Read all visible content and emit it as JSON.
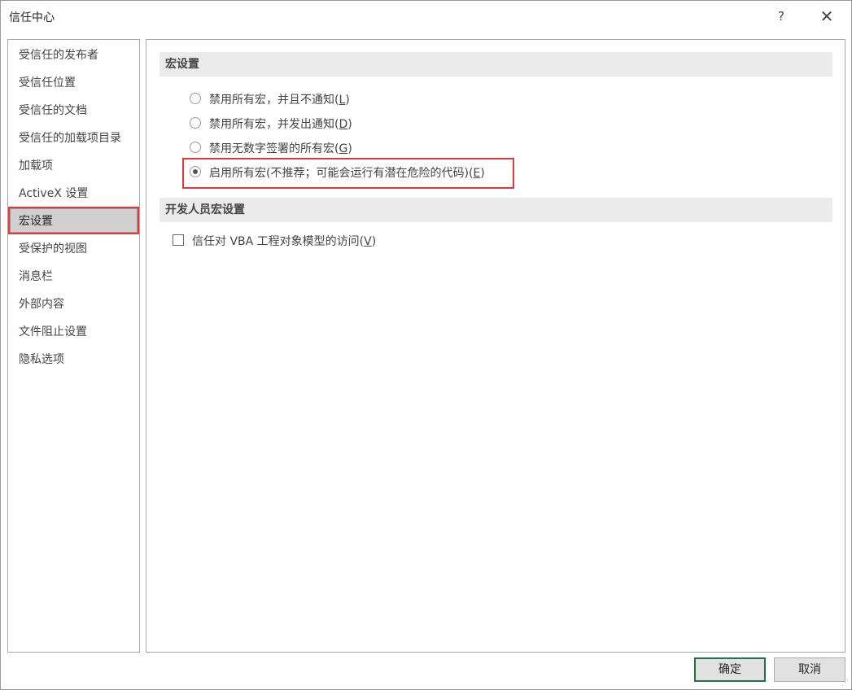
{
  "window": {
    "title": "信任中心",
    "help_glyph": "?",
    "close_glyph": "✕"
  },
  "sidebar": {
    "items": [
      {
        "label": "受信任的发布者"
      },
      {
        "label": "受信任位置"
      },
      {
        "label": "受信任的文档"
      },
      {
        "label": "受信任的加载项目录"
      },
      {
        "label": "加载项"
      },
      {
        "label": "ActiveX 设置"
      },
      {
        "label": "宏设置",
        "selected": true
      },
      {
        "label": "受保护的视图"
      },
      {
        "label": "消息栏"
      },
      {
        "label": "外部内容"
      },
      {
        "label": "文件阻止设置"
      },
      {
        "label": "隐私选项"
      }
    ]
  },
  "macro_settings": {
    "header": "宏设置",
    "options": [
      {
        "text": "禁用所有宏，并且不通知",
        "key": "L",
        "checked": false
      },
      {
        "text": "禁用所有宏，并发出通知",
        "key": "D",
        "checked": false
      },
      {
        "text": "禁用无数字签署的所有宏",
        "key": "G",
        "checked": false
      },
      {
        "text": "启用所有宏(不推荐；可能会运行有潜在危险的代码)",
        "key": "E",
        "checked": true
      }
    ]
  },
  "developer_settings": {
    "header": "开发人员宏设置",
    "checkbox_text": "信任对 VBA 工程对象模型的访问",
    "checkbox_key": "V",
    "checked": false
  },
  "buttons": {
    "ok": "确定",
    "cancel": "取消"
  },
  "colors": {
    "highlight": "#e53935",
    "primary_border": "#217346"
  }
}
